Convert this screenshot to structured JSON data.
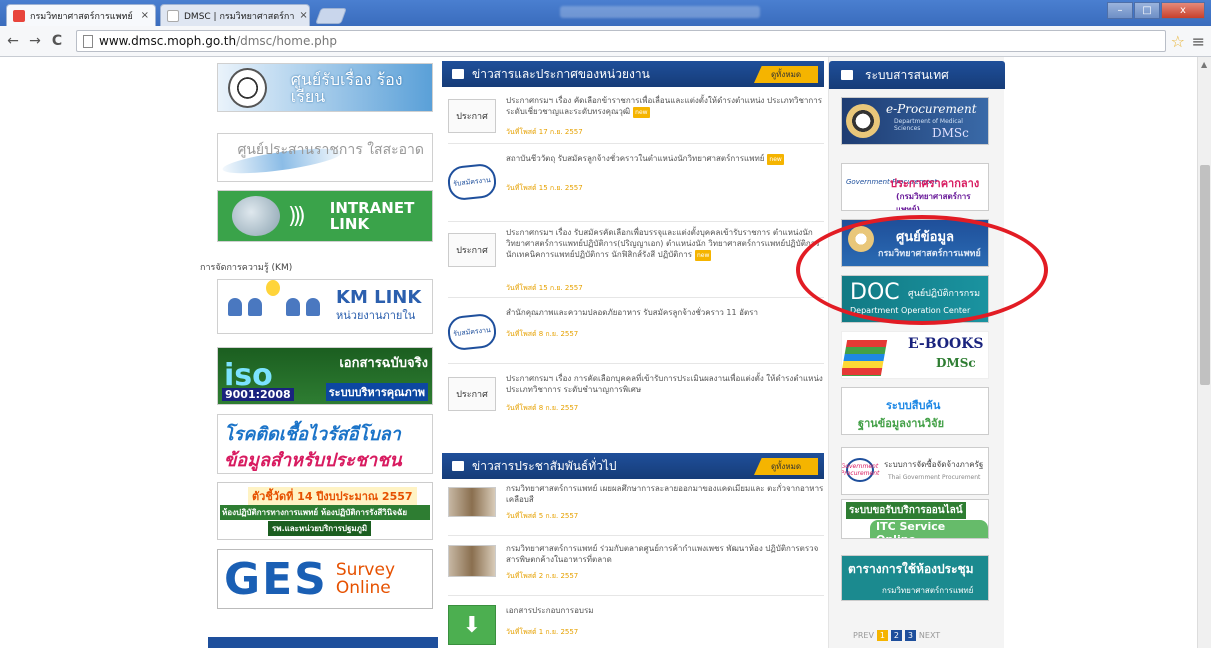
{
  "browser": {
    "tabs": [
      {
        "label": "กรมวิทยาศาสตร์การแพทย์",
        "active": true
      },
      {
        "label": "DMSC | กรมวิทยาศาสตร์กา",
        "active": false
      }
    ],
    "tab_close": "×",
    "window_controls": {
      "minimize": "–",
      "maximize": "□",
      "close": "x"
    },
    "url_host": "www.dmsc.moph.go.th",
    "url_path": "/dmsc/home.php",
    "icons": {
      "back": "back-icon",
      "forward": "forward-icon",
      "reload": "reload-icon",
      "star": "star-icon",
      "menu": "menu-icon"
    },
    "glyphs": {
      "back": "←",
      "forward": "→",
      "reload": "C",
      "star": "☆",
      "menu": "≡"
    }
  },
  "left_banners": {
    "complaint": "ศูนย์รับเรื่อง ร้องเรียน",
    "clean_gov": "ศูนย์ประสานราชการ ใสสะอาด",
    "intranet_line1": "INTRANET",
    "intranet_line2": "LINK",
    "intranet_waves": ")))",
    "km_label": "การจัดการความรู้ (KM)",
    "km_title": "KM LINK",
    "km_sub": "หน่วยงานภายใน",
    "iso_big": "iso",
    "iso_right": "เอกสารฉบับจริง",
    "iso_code": "9001:2008",
    "iso_system": "ระบบบริหารคุณภาพ",
    "ebola_line1": "โรคติดเชื้อไวรัสอีโบลา",
    "ebola_line2": "ข้อมูลสำหรับประชาชน",
    "kpi_line1": "ตัวชี้วัดที่ 14 ปีงบประมาณ 2557",
    "kpi_line2": "ห้องปฏิบัติการทางการแพทย์ ห้องปฏิบัติการรังสีวินิจฉัย",
    "kpi_line3": "รพ.และหน่วยบริการปฐมภูมิ",
    "ges_big": "GES",
    "ges_survey": "Survey",
    "ges_online": "Online"
  },
  "news": {
    "heading": "ข่าวสารและประกาศของหน่วยงาน",
    "all_label": "ดูทั้งหมด",
    "new_label": "new",
    "items": [
      {
        "thumb": "ประกาศ",
        "title": "ประกาศกรมฯ เรื่อง คัดเลือกข้าราชการเพื่อเลื่อนและแต่งตั้งให้ดำรงตำแหน่ง ประเภทวิชาการ ระดับเชี่ยวชาญและระดับทรงคุณวุฒิ",
        "date": "วันที่โพสต์ 17 ก.ย. 2557"
      },
      {
        "thumb": "รับสมัครงาน",
        "title": "สถาบันชีววัตถุ รับสมัครลูกจ้างชั่วคราวในตำแหน่งนักวิทยาศาสตร์การแพทย์",
        "date": "วันที่โพสต์ 15 ก.ย. 2557"
      },
      {
        "thumb": "ประกาศ",
        "title": "ประกาศกรมฯ เรื่อง รับสมัครคัดเลือกเพื่อบรรจุและแต่งตั้งบุคคลเข้ารับราชการ ตำแหน่งนักวิทยาศาสตร์การแพทย์ปฏิบัติการ(ปริญญาเอก) ตำแหน่งนัก วิทยาศาสตร์การแพทย์ปฏิบัติการ นักเทคนิคการแพทย์ปฏิบัติการ นักฟิสิกส์รังสี ปฏิบัติการ",
        "date": "วันที่โพสต์ 15 ก.ย. 2557"
      },
      {
        "thumb": "รับสมัครงาน",
        "title": "สำนักคุณภาพและความปลอดภัยอาหาร รับสมัครลูกจ้างชั่วคราว 11 อัตรา",
        "date": "วันที่โพสต์ 8 ก.ย. 2557"
      },
      {
        "thumb": "ประกาศ",
        "title": "ประกาศกรมฯ เรื่อง การคัดเลือกบุคคลที่เข้ารับการประเมินผลงานเพื่อแต่งตั้ง ให้ดำรงตำแหน่งประเภทวิชาการ ระดับชำนาญการพิเศษ",
        "date": "วันที่โพสต์ 8 ก.ย. 2557"
      }
    ]
  },
  "pr": {
    "heading": "ข่าวสารประชาสัมพันธ์ทั่วไป",
    "all_label": "ดูทั้งหมด",
    "download_glyph": "⬇",
    "items": [
      {
        "title": "กรมวิทยาศาสตร์การแพทย์ เผยผลศึกษาการละลายออกมาของแคดเมียมและ ตะกั่วจากอาหารเคลือบสี",
        "date": "วันที่โพสต์ 5 ก.ย. 2557"
      },
      {
        "title": "กรมวิทยาศาสตร์การแพทย์ ร่วมกับตลาดศูนย์การค้ากำแพงเพชร พัฒนาห้อง ปฏิบัติการตรวจสารพิษตกค้างในอาหารที่ตลาด",
        "date": "วันที่โพสต์ 2 ก.ย. 2557"
      },
      {
        "title": "เอกสารประกอบการอบรม",
        "date": "วันที่โพสต์ 1 ก.ย. 2557"
      }
    ]
  },
  "info_systems": {
    "heading": "ระบบสารสนเทศ",
    "eproc_t1": "e-Procurement",
    "eproc_t2": "Department of Medical Sciences",
    "eproc_t3": "DMSc",
    "gov_logo": "Government Procurement",
    "gov_t1": "ประกาศราคากลาง",
    "gov_t2": "(กรมวิทยาศาสตร์การแพทย์)",
    "data_t1": "ศูนย์ข้อมูล",
    "data_t2": "กรมวิทยาศาสตร์การแพทย์",
    "doc_big": "DOC",
    "doc_t1": "ศูนย์ปฏิบัติการกรม",
    "doc_t2": "Department Operation Center",
    "ebooks_t1": "E-BOOKS",
    "ebooks_t2": "DMSc",
    "research_t1": "ระบบสืบค้น",
    "research_t2": "ฐานข้อมูลงานวิจัย",
    "proc_logo": "Government Procurement",
    "proc_t1": "ระบบการจัดซื้อจัดจ้างภาครัฐ",
    "proc_t2": "Thai Government Procurement",
    "itc_t1": "ระบบขอรับบริการออนไลน์",
    "itc_t2": "ITC Service Online",
    "room_t1": "ตารางการใช้ห้องประชุม",
    "room_t2": "กรมวิทยาศาสตร์การแพทย์",
    "pager_prev": "PREV",
    "pager_next": "NEXT",
    "pages": [
      "1",
      "2",
      "3"
    ]
  }
}
